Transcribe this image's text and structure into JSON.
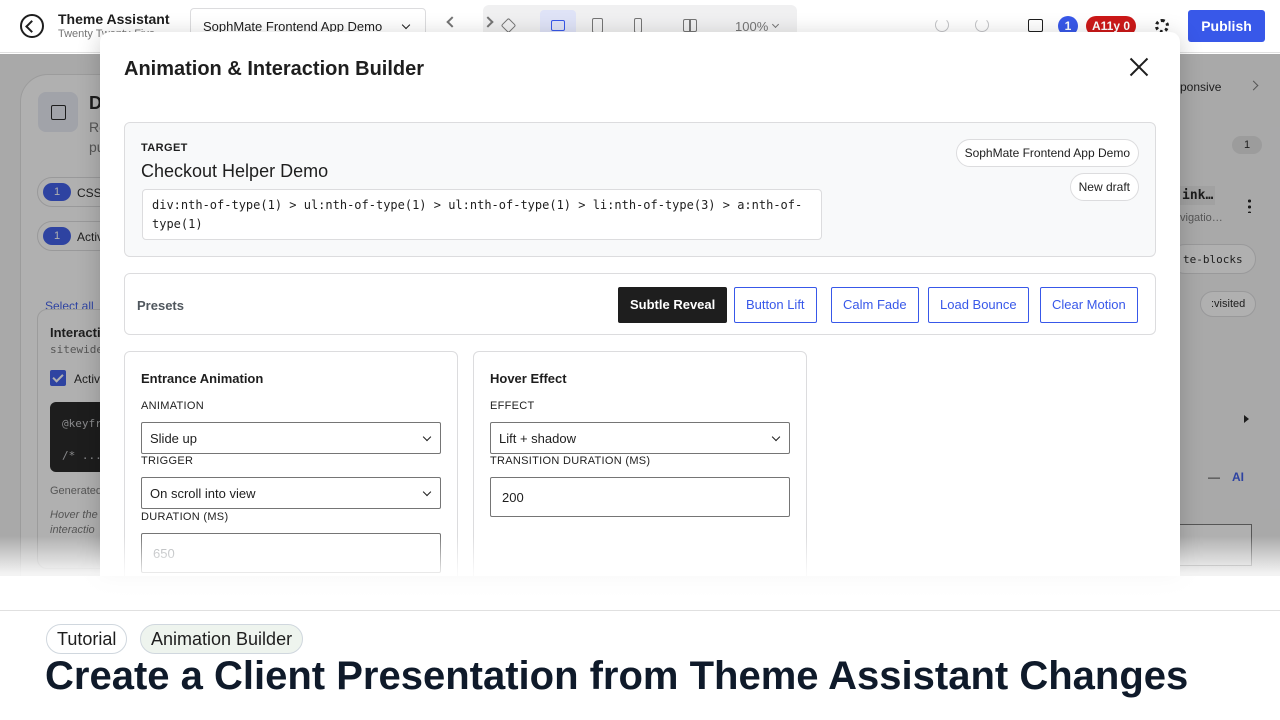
{
  "topbar": {
    "app_title": "Theme Assistant",
    "app_subtitle": "Twenty Twenty-Five",
    "site_selector": "SophMate Frontend App Demo",
    "zoom": "100%",
    "comment_count": "1",
    "a11y_label": "A11y 0",
    "publish_label": "Publish"
  },
  "background": {
    "panel_heading": "D",
    "panel_desc_1": "Re",
    "panel_desc_2": "pu",
    "chips": [
      {
        "count": "1",
        "label": "CSS"
      },
      {
        "count": "1",
        "label": "Activ"
      }
    ],
    "select_all": "Select all",
    "inner_title": "Interacti",
    "inner_scope": "sitewide",
    "inner_check_label": "Activ",
    "code_line_1": "@keyfr",
    "code_line_2": "/* ...",
    "generated": "Generated",
    "hover_note_1": "Hover the",
    "hover_note_2": "interactio",
    "right_responsive": "ponsive",
    "right_count": "1",
    "right_ink": "ink…",
    "right_navi": "vigatio…",
    "right_blocks": "te-blocks",
    "right_visited": ":visited",
    "right_dash": "—",
    "right_ai": "AI"
  },
  "modal": {
    "title": "Animation & Interaction Builder",
    "target": {
      "label": "TARGET",
      "name": "Checkout Helper Demo",
      "selector": "div:nth-of-type(1) > ul:nth-of-type(1) > ul:nth-of-type(1) > li:nth-of-type(3) > a:nth-of-type(1)",
      "site_pill": "SophMate Frontend App Demo",
      "draft_pill": "New draft"
    },
    "presets": {
      "label": "Presets",
      "buttons": [
        "Subtle Reveal",
        "Button Lift",
        "Calm Fade",
        "Load Bounce",
        "Clear Motion"
      ],
      "active": "Subtle Reveal"
    },
    "entrance": {
      "title": "Entrance Animation",
      "animation_label": "ANIMATION",
      "animation_value": "Slide up",
      "trigger_label": "TRIGGER",
      "trigger_value": "On scroll into view",
      "duration_label": "DURATION (MS)",
      "duration_placeholder": "650"
    },
    "hover": {
      "title": "Hover Effect",
      "effect_label": "EFFECT",
      "effect_value": "Lift + shadow",
      "transition_label": "TRANSITION DURATION (MS)",
      "transition_value": "200"
    }
  },
  "caption": {
    "tags": [
      "Tutorial",
      "Animation Builder"
    ],
    "headline": "Create a Client Presentation from Theme Assistant Changes"
  },
  "colors": {
    "accent": "#3858e9",
    "danger": "#cc1818",
    "dark": "#1e1e1e"
  }
}
